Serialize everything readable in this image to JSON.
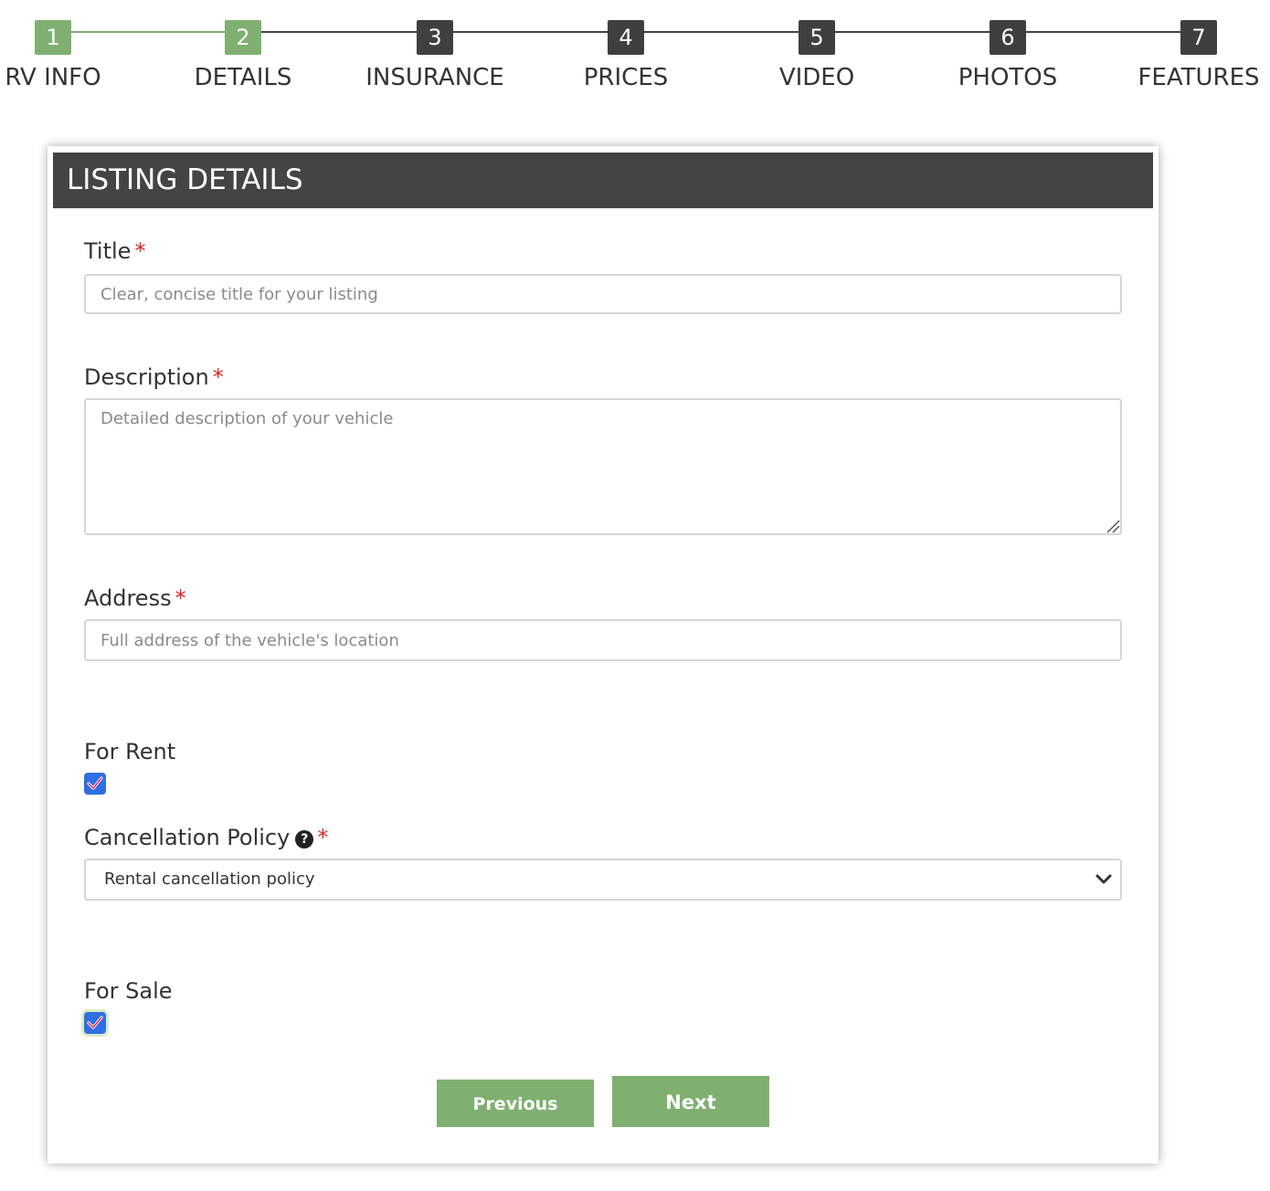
{
  "stepper": {
    "steps": [
      {
        "number": "1",
        "label": "RV INFO",
        "status": "complete"
      },
      {
        "number": "2",
        "label": "DETAILS",
        "status": "current"
      },
      {
        "number": "3",
        "label": "INSURANCE",
        "status": "upcoming"
      },
      {
        "number": "4",
        "label": "PRICES",
        "status": "upcoming"
      },
      {
        "number": "5",
        "label": "VIDEO",
        "status": "upcoming"
      },
      {
        "number": "6",
        "label": "PHOTOS",
        "status": "upcoming"
      },
      {
        "number": "7",
        "label": "FEATURES",
        "status": "upcoming"
      }
    ]
  },
  "card": {
    "title": "LISTING DETAILS"
  },
  "form": {
    "required_mark": "*",
    "title": {
      "label": "Title",
      "value": "",
      "placeholder": "Clear, concise title for your listing"
    },
    "description": {
      "label": "Description",
      "value": "",
      "placeholder": "Detailed description of your vehicle"
    },
    "address": {
      "label": "Address",
      "value": "",
      "placeholder": "Full address of the vehicle's location"
    },
    "for_rent": {
      "label": "For Rent",
      "checked": true
    },
    "cancellation_policy": {
      "label": "Cancellation Policy",
      "help_glyph": "?",
      "selected": "Rental cancellation policy"
    },
    "for_sale": {
      "label": "For Sale",
      "checked": true
    }
  },
  "buttons": {
    "previous": "Previous",
    "next": "Next"
  },
  "colors": {
    "accent_green": "#7fb070",
    "header_dark": "#444444",
    "step_dark": "#3f3f3f",
    "required_red": "#e02424",
    "checkbox_blue": "#2f6fe0"
  }
}
